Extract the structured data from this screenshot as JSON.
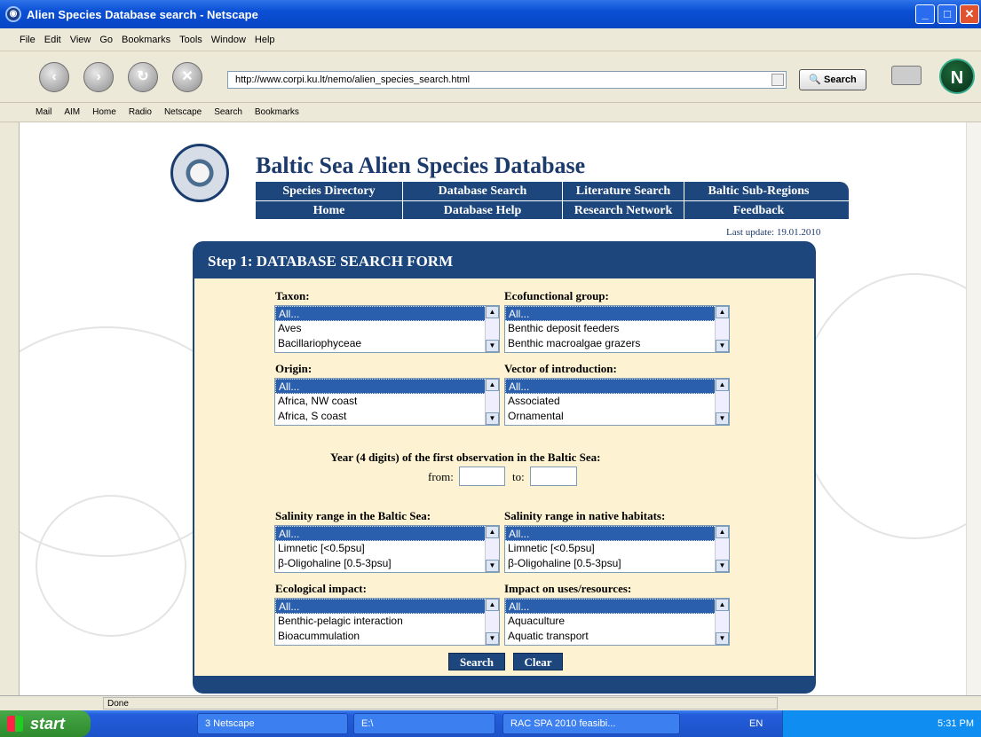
{
  "window": {
    "title": "Alien Species Database search - Netscape",
    "minimize": "_",
    "maximize": "□",
    "close": "✕"
  },
  "menu": [
    "File",
    "Edit",
    "View",
    "Go",
    "Bookmarks",
    "Tools",
    "Window",
    "Help"
  ],
  "nav": {
    "back": "‹",
    "forward": "›",
    "reload": "↻",
    "stop": "✕",
    "url": "http://www.corpi.ku.lt/nemo/alien_species_search.html",
    "search_label": "Search",
    "logo_letter": "N"
  },
  "bookmarks": [
    "Mail",
    "AIM",
    "Home",
    "Radio",
    "Netscape",
    "Search",
    "Bookmarks"
  ],
  "site": {
    "title": "Baltic Sea Alien Species Database",
    "nav_row1": [
      "Species Directory",
      "Database Search",
      "Literature Search",
      "Baltic Sub-Regions"
    ],
    "nav_row2": [
      "Home",
      "Database Help",
      "Research Network",
      "Feedback"
    ],
    "last_update": "Last update: 19.01.2010"
  },
  "form": {
    "heading": "Step 1: DATABASE SEARCH FORM",
    "taxon": {
      "label": "Taxon:",
      "options": [
        "All...",
        "Aves",
        "Bacillariophyceae"
      ]
    },
    "ecofunctional": {
      "label": "Ecofunctional group:",
      "options": [
        "All...",
        "Benthic deposit feeders",
        "Benthic macroalgae grazers"
      ]
    },
    "origin": {
      "label": "Origin:",
      "options": [
        "All...",
        "Africa, NW coast",
        "Africa, S coast"
      ]
    },
    "vector": {
      "label": "Vector of introduction:",
      "options": [
        "All...",
        "Associated",
        "Ornamental"
      ]
    },
    "year_question": "Year (4 digits) of the first observation in the Baltic Sea:",
    "from_label": "from:",
    "to_label": "to:",
    "from_value": "",
    "to_value": "",
    "salinity_baltic": {
      "label": "Salinity range in the Baltic Sea:",
      "options": [
        "All...",
        "Limnetic [<0.5psu]",
        "β-Oligohaline [0.5-3psu]"
      ]
    },
    "salinity_native": {
      "label": "Salinity range in native habitats:",
      "options": [
        "All...",
        "Limnetic [<0.5psu]",
        "β-Oligohaline [0.5-3psu]"
      ]
    },
    "ecological_impact": {
      "label": "Ecological impact:",
      "options": [
        "All...",
        "Benthic-pelagic interaction",
        "Bioacummulation"
      ]
    },
    "impact_uses": {
      "label": "Impact on uses/resources:",
      "options": [
        "All...",
        "Aquaculture",
        "Aquatic transport"
      ]
    },
    "search_button": "Search",
    "clear_button": "Clear"
  },
  "status": {
    "text": "Done"
  },
  "taskbar": {
    "start": "start",
    "tasks": [
      "3 Netscape",
      "E:\\",
      "RAC SPA 2010 feasibi..."
    ],
    "lang": "EN",
    "time": "5:31 PM"
  },
  "colors": {
    "brand_navy": "#1d477c",
    "form_bg": "#fdf2d2",
    "selected_option": "#2a5fae"
  }
}
